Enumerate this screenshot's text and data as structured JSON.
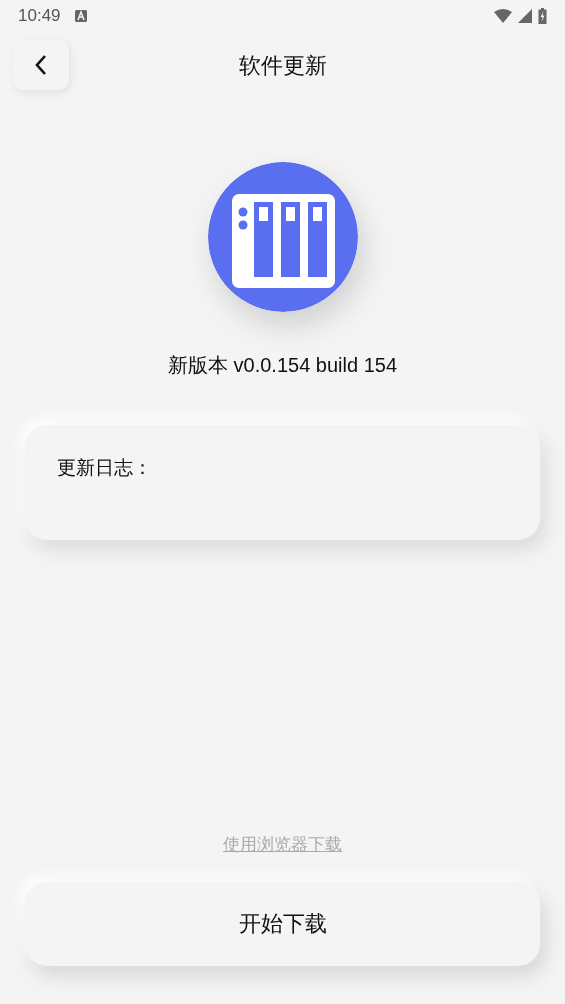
{
  "status_bar": {
    "time": "10:49"
  },
  "header": {
    "title": "软件更新"
  },
  "update": {
    "version": "新版本 v0.0.154 build 154",
    "changelog_label": "更新日志："
  },
  "browser_link": "使用浏览器下载",
  "download_button": "开始下载"
}
